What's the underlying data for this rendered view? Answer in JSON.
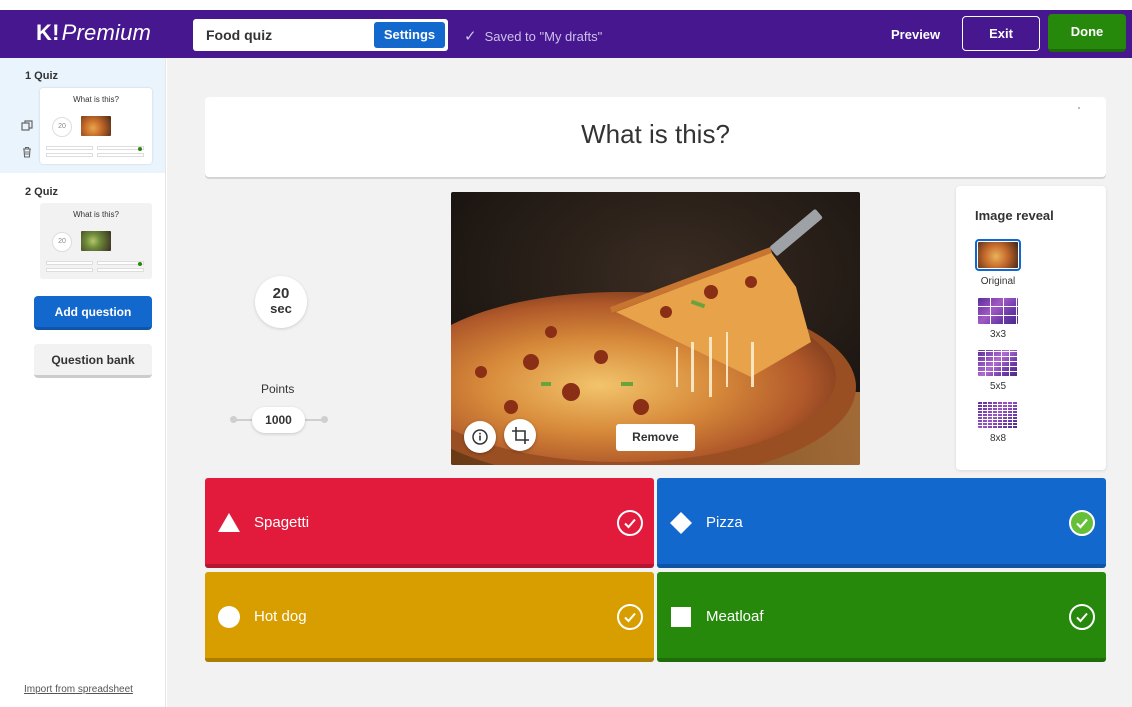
{
  "app": {
    "logo_k": "K!",
    "logo_text": "Premium"
  },
  "header": {
    "title": "Food quiz",
    "settings_label": "Settings",
    "saved_text": "Saved to \"My drafts\"",
    "preview_label": "Preview",
    "exit_label": "Exit",
    "done_label": "Done"
  },
  "sidebar": {
    "questions": [
      {
        "label": "1  Quiz",
        "preview_question": "What is this?",
        "timer": "20"
      },
      {
        "label": "2  Quiz",
        "preview_question": "What is this?",
        "timer": "20"
      }
    ],
    "add_question_label": "Add question",
    "question_bank_label": "Question bank",
    "import_label": "Import from spreadsheet"
  },
  "question": {
    "text": "What is this?",
    "timer_value": "20",
    "timer_unit": "sec",
    "points_label": "Points",
    "points_value": "1000"
  },
  "media": {
    "remove_label": "Remove"
  },
  "image_reveal": {
    "title": "Image reveal",
    "options": [
      {
        "label": "Original",
        "selected": true
      },
      {
        "label": "3x3",
        "selected": false
      },
      {
        "label": "5x5",
        "selected": false
      },
      {
        "label": "8x8",
        "selected": false
      }
    ]
  },
  "answers": [
    {
      "text": "Spagetti",
      "color": "#e21b3c",
      "shape": "triangle",
      "correct": false
    },
    {
      "text": "Pizza",
      "color": "#1368ce",
      "shape": "diamond",
      "correct": true
    },
    {
      "text": "Hot dog",
      "color": "#d89e00",
      "shape": "circle",
      "correct": false
    },
    {
      "text": "Meatloaf",
      "color": "#26890c",
      "shape": "square",
      "correct": false
    }
  ],
  "colors": {
    "brand_purple": "#46178f",
    "primary_blue": "#1368ce",
    "done_green": "#26890c",
    "correct_green": "#66bf39"
  }
}
